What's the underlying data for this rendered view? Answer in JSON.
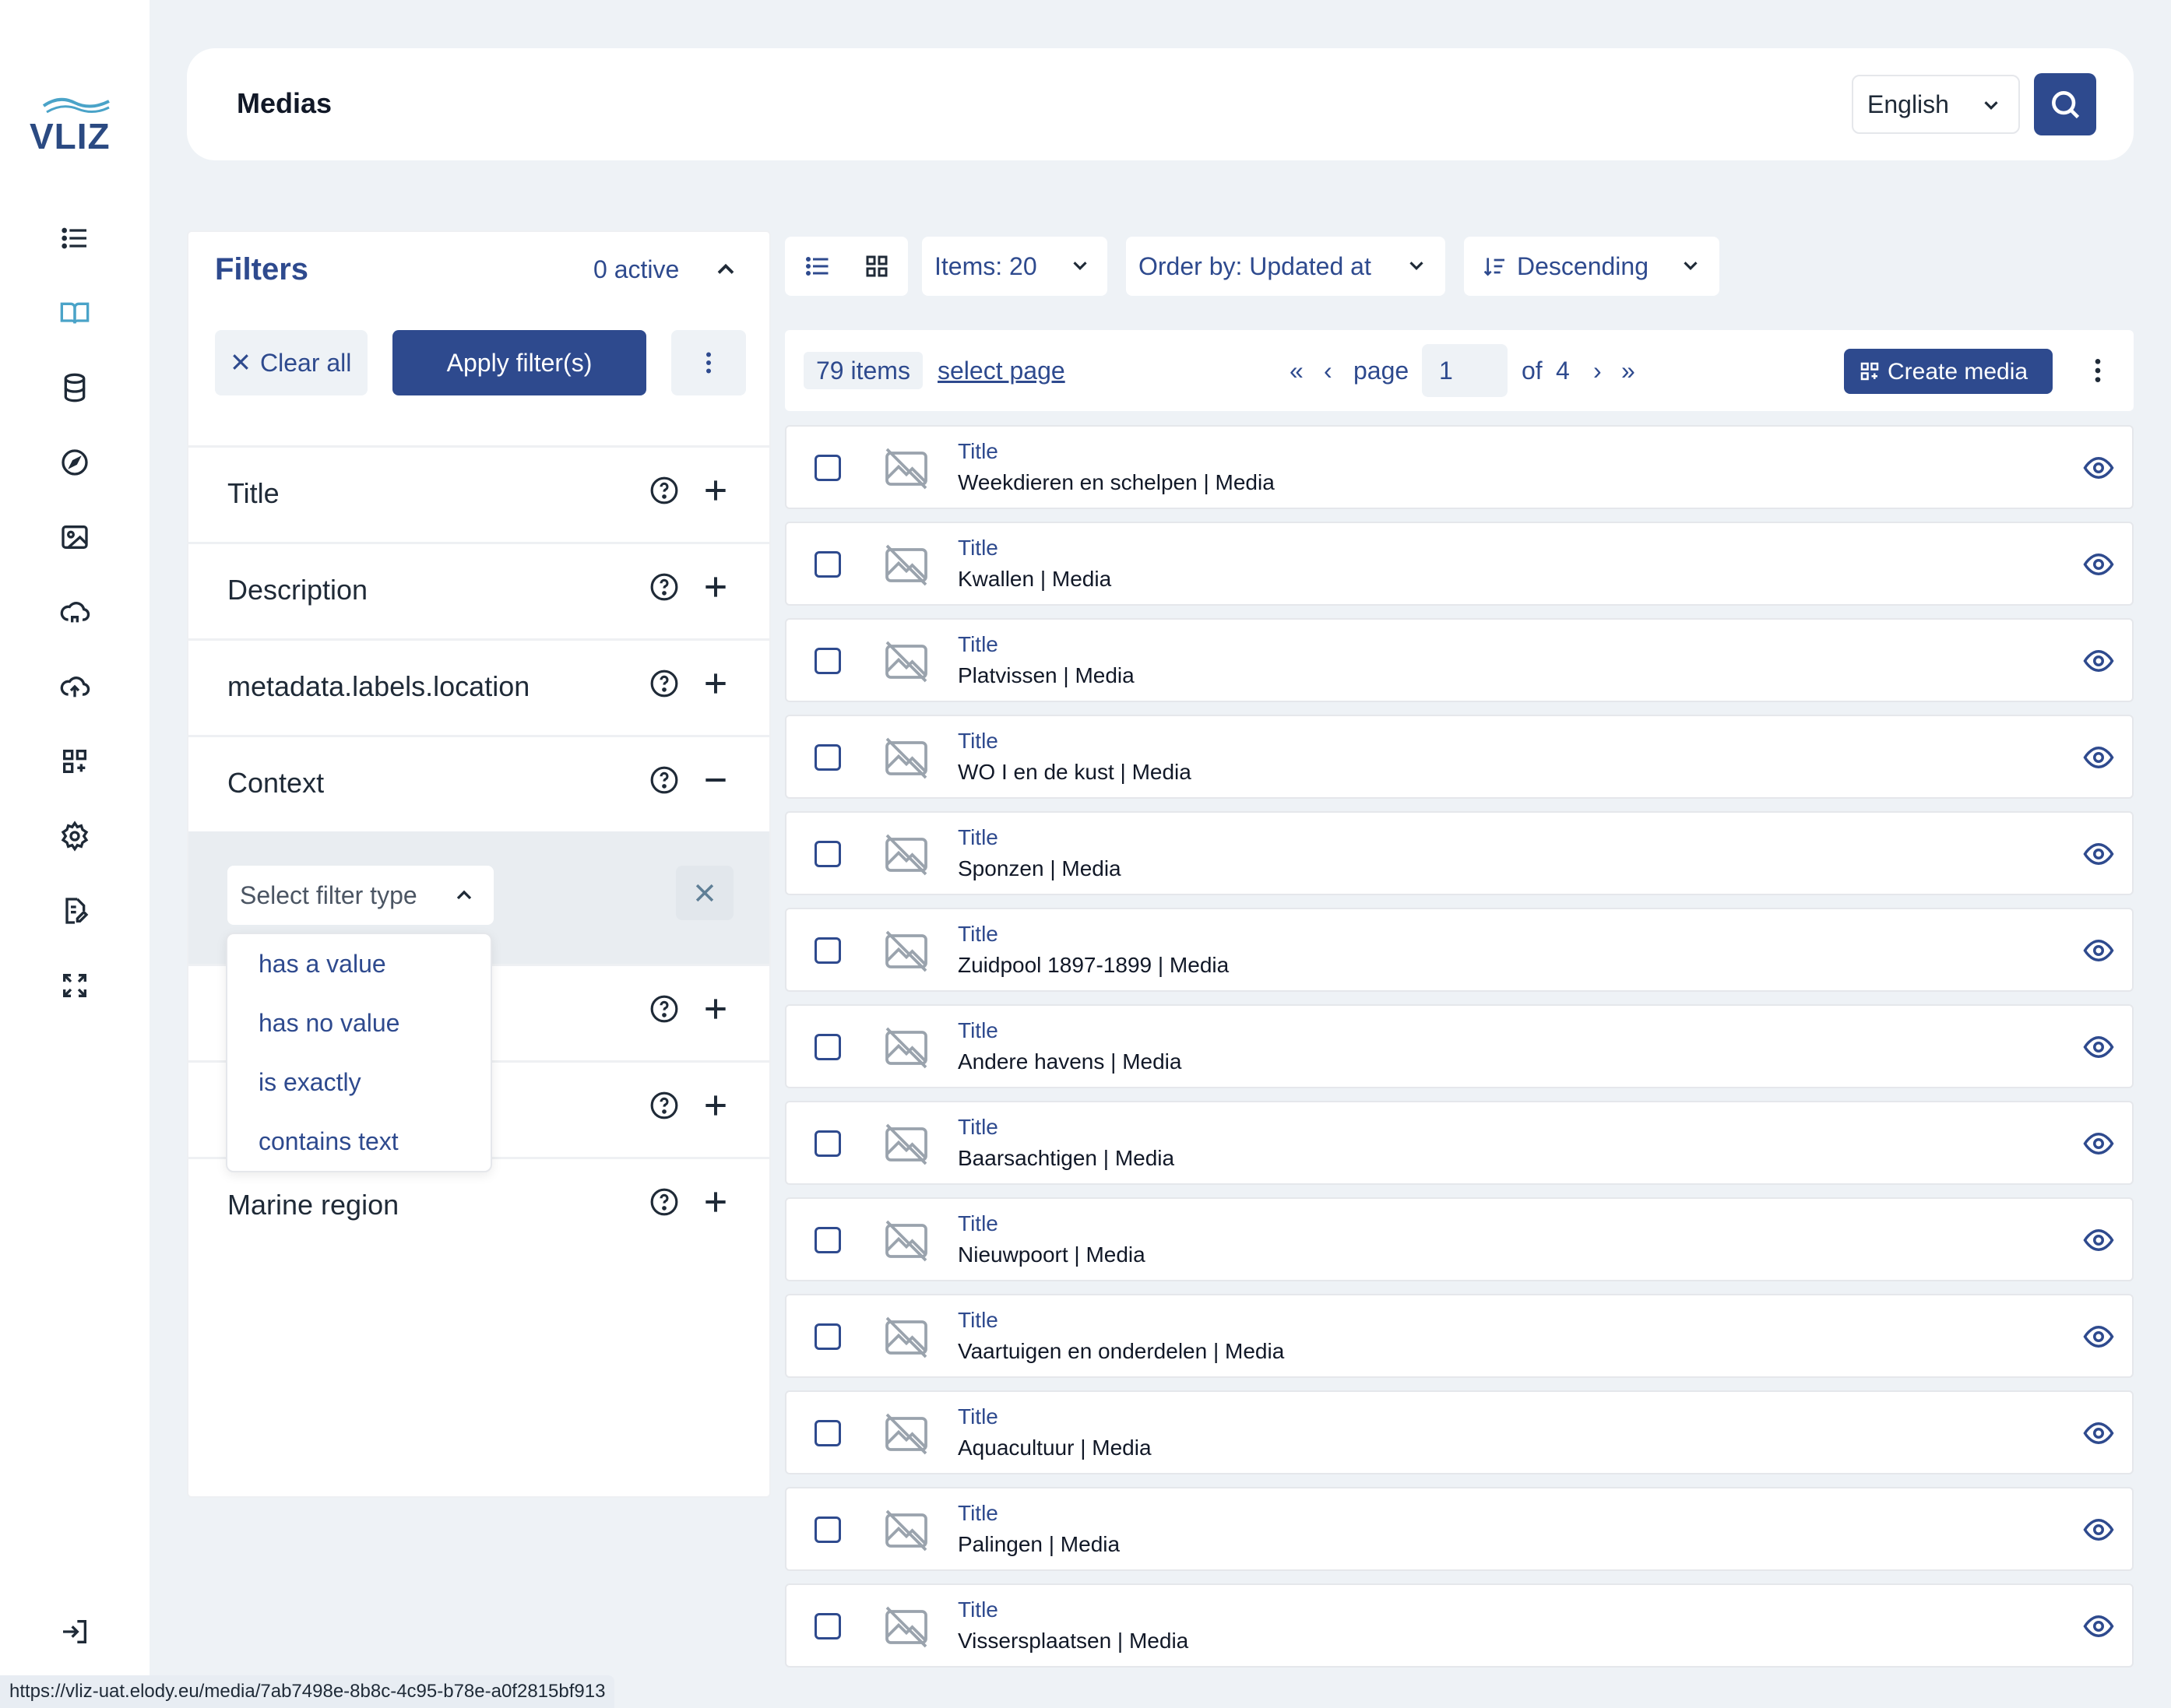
{
  "app": {
    "logo": "VLIZ"
  },
  "sidebar": {
    "icons": [
      "list-icon",
      "book-icon",
      "database-icon",
      "compass-icon",
      "image-icon",
      "cloud-home-icon",
      "cloud-upload-icon",
      "apps-add-icon",
      "settings-icon",
      "document-edit-icon",
      "expand-icon"
    ],
    "bottom_icon": "logout-icon"
  },
  "header": {
    "title": "Medias",
    "language": "English"
  },
  "filters": {
    "title": "Filters",
    "active": "0 active",
    "clear_label": "Clear all",
    "apply_label": "Apply filter(s)",
    "rows": [
      {
        "name": "Title",
        "toggle": "+"
      },
      {
        "name": "Description",
        "toggle": "+"
      },
      {
        "name": "metadata.labels.location",
        "toggle": "+"
      },
      {
        "name": "Context",
        "toggle": "-"
      },
      {
        "name": "",
        "toggle": "+"
      },
      {
        "name": "",
        "toggle": "+"
      },
      {
        "name": "Marine region",
        "toggle": "+"
      }
    ],
    "filter_type_placeholder": "Select filter type",
    "filter_type_options": [
      "has a value",
      "has no value",
      "is exactly",
      "contains text"
    ]
  },
  "toolbar": {
    "items": "Items: 20",
    "order_by": "Order by: Updated at",
    "direction": "Descending"
  },
  "pager": {
    "count": "79 items",
    "select_page": "select page",
    "first": "«",
    "prev": "‹",
    "page_label": "page",
    "page_value": "1",
    "of_label": "of",
    "total_pages": "4",
    "next": "›",
    "last": "»",
    "create_label": "Create media"
  },
  "media_list": {
    "field_label": "Title",
    "items": [
      "Weekdieren en schelpen | Media",
      "Kwallen | Media",
      "Platvissen | Media",
      "WO I en de kust | Media",
      "Sponzen | Media",
      "Zuidpool 1897-1899 | Media",
      "Andere havens | Media",
      "Baarsachtigen | Media",
      "Nieuwpoort | Media",
      "Vaartuigen en onderdelen | Media",
      "Aquacultuur | Media",
      "Palingen | Media",
      "Vissersplaatsen | Media"
    ]
  },
  "status_bar": {
    "url": "https://vliz-uat.elody.eu/media/7ab7498e-8b8c-4c95-b78e-a0f2815bf913"
  },
  "colors": {
    "accent": "#2e4a8e",
    "background": "#eef2f6",
    "active_nav": "#4aa3c8"
  }
}
